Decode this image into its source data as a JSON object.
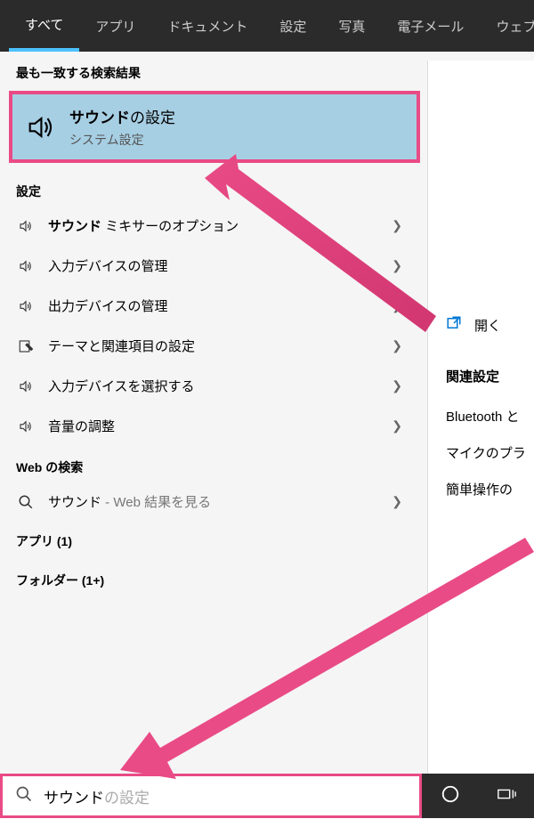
{
  "tabs": {
    "all": "すべて",
    "apps": "アプリ",
    "documents": "ドキュメント",
    "settings": "設定",
    "photos": "写真",
    "email": "電子メール",
    "web": "ウェブ"
  },
  "sections": {
    "best_match": "最も一致する検索結果",
    "settings": "設定",
    "web_search": "Web の検索",
    "apps": "アプリ",
    "apps_count": "(1)",
    "folders": "フォルダー",
    "folders_count": "(1+)"
  },
  "best_match": {
    "title_bold": "サウンド",
    "title_rest": "の設定",
    "subtitle": "システム設定"
  },
  "results": [
    {
      "label_bold": "サウンド",
      "label_rest": " ミキサーのオプション",
      "icon": "sound"
    },
    {
      "label_bold": "",
      "label_rest": "入力デバイスの管理",
      "icon": "sound"
    },
    {
      "label_bold": "",
      "label_rest": "出力デバイスの管理",
      "icon": "sound"
    },
    {
      "label_bold": "",
      "label_rest": "テーマと関連項目の設定",
      "icon": "edit"
    },
    {
      "label_bold": "",
      "label_rest": "入力デバイスを選択する",
      "icon": "sound"
    },
    {
      "label_bold": "",
      "label_rest": "音量の調整",
      "icon": "sound"
    }
  ],
  "web_result": {
    "label": "サウンド",
    "suffix": " - Web 結果を見る"
  },
  "search": {
    "typed": "サウンド",
    "placeholder_suffix": "の設定"
  },
  "right_panel": {
    "open": "開く",
    "related_header": "関連設定",
    "links": [
      "Bluetooth と",
      "マイクのプラ",
      "簡単操作の"
    ]
  }
}
